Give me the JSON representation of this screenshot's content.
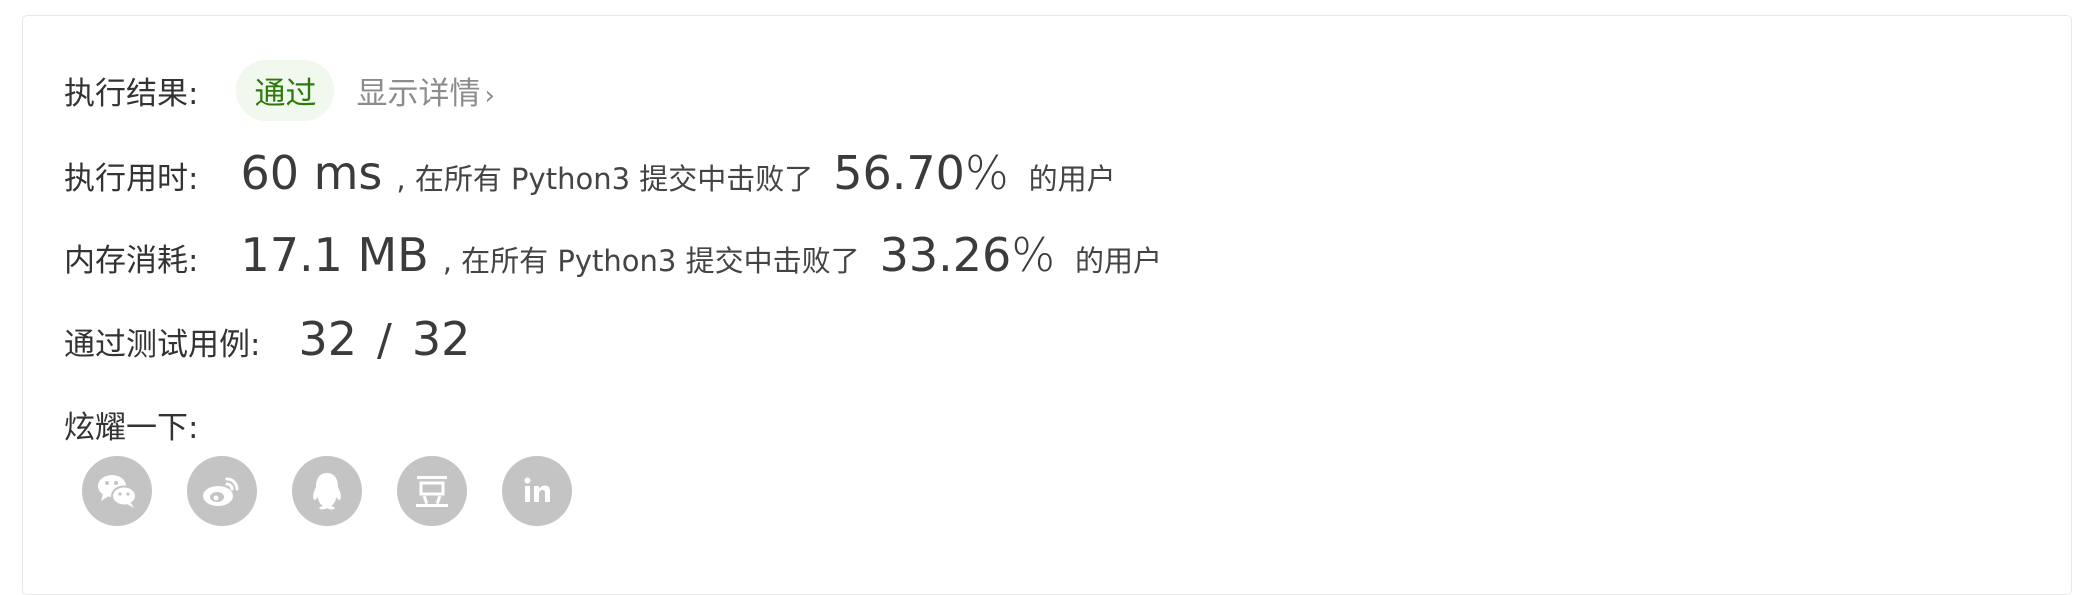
{
  "result": {
    "label": "执行结果:",
    "status": "通过",
    "detail_link": "显示详情",
    "chevron": "›"
  },
  "runtime": {
    "label": "执行用时:",
    "value": "60 ms",
    "mid_text": ", 在所有 Python3 提交中击败了",
    "percent": "56.70",
    "percent_sign": "%",
    "suffix": "的用户"
  },
  "memory": {
    "label": "内存消耗:",
    "value": "17.1 MB",
    "mid_text": ", 在所有 Python3 提交中击败了",
    "percent": "33.26",
    "percent_sign": "%",
    "suffix": "的用户"
  },
  "testcases": {
    "label": "通过测试用例:",
    "passed": "32",
    "separator": "/",
    "total": "32"
  },
  "share": {
    "label": "炫耀一下:",
    "icons": [
      "wechat-icon",
      "weibo-icon",
      "qq-icon",
      "douban-icon",
      "linkedin-icon"
    ]
  },
  "colors": {
    "pass_green": "#2d7a0a",
    "pass_bg": "#f1f8ee",
    "icon_grey": "#c4c4c4"
  }
}
